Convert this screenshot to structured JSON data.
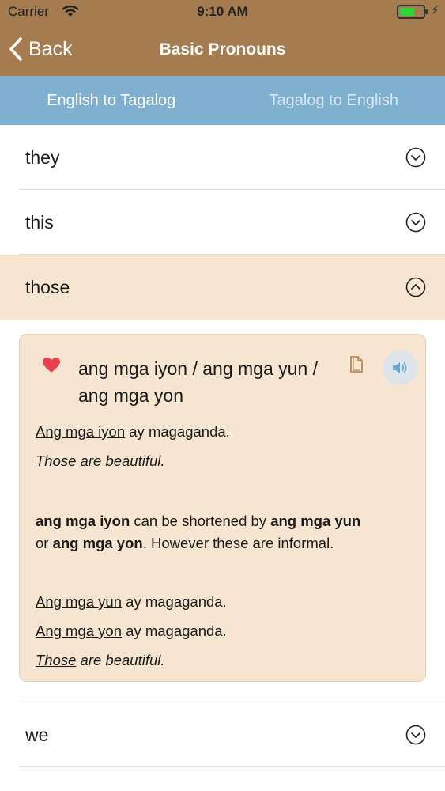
{
  "status": {
    "carrier": "Carrier",
    "time": "9:10 AM",
    "battery_level": 0.5
  },
  "nav": {
    "back_label": "Back",
    "title": "Basic Pronouns"
  },
  "tabs": [
    {
      "label": "English to Tagalog",
      "active": true
    },
    {
      "label": "Tagalog to English",
      "active": false
    }
  ],
  "rows": {
    "they": "they",
    "this": "this",
    "those": "those",
    "we": "we"
  },
  "detail": {
    "phrase": "ang mga iyon / ang mga yun / ang mga yon",
    "example1": {
      "underlined": "Ang mga iyon",
      "rest": " ay magaganda."
    },
    "translation1": {
      "underlined": "Those",
      "rest": " are beautiful."
    },
    "note": {
      "b1": "ang mga iyon",
      "t1": " can be shortened by ",
      "b2": "ang mga yun",
      "t2": " or ",
      "b3": "ang mga yon",
      "t3": ". However these are informal."
    },
    "example2": {
      "underlined": "Ang mga yun",
      "rest": " ay magaganda."
    },
    "example3": {
      "underlined": "Ang mga yon",
      "rest": " ay magaganda."
    },
    "translation2": {
      "underlined": "Those",
      "rest": " are beautiful."
    }
  },
  "colors": {
    "header": "#a47c4f",
    "tabs": "#7fb0cf",
    "expanded": "#f5e5d1",
    "heart": "#e8404f"
  },
  "icons": [
    "wifi-icon",
    "battery-icon",
    "back-chevron-icon",
    "chevron-down-circle-icon",
    "chevron-up-circle-icon",
    "heart-icon",
    "copy-icon",
    "speaker-icon"
  ]
}
